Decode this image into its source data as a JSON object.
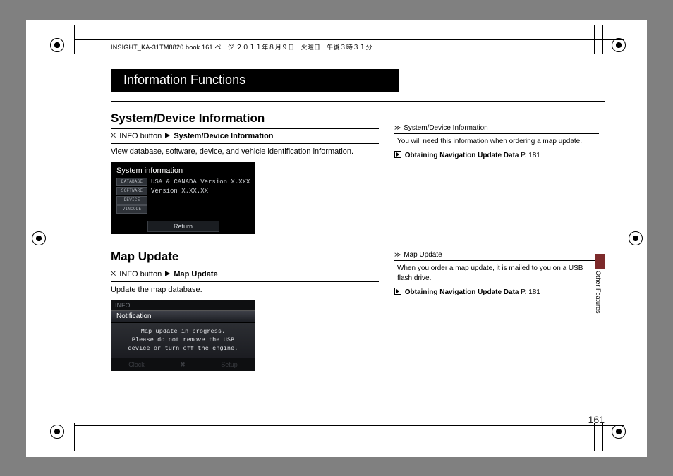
{
  "file_header": "INSIGHT_KA-31TM8820.book  161 ページ  ２０１１年８月９日　火曜日　午後３時３１分",
  "banner_title": "Information Functions",
  "section_a": {
    "heading": "System/Device Information",
    "nav_prefix": "INFO button",
    "nav_target": "System/Device Information",
    "body": "View database, software, device, and vehicle identification information.",
    "screenshot": {
      "title": "System information",
      "rows": {
        "database_label": "DATABASE",
        "database_value": "USA & CANADA Version X.XXX",
        "software_label": "SOFTWARE",
        "software_value": "Version X.XX.XX",
        "device_label": "DEVICE",
        "vincode_label": "VINCODE"
      },
      "return_btn": "Return"
    }
  },
  "section_b": {
    "heading": "Map Update",
    "nav_prefix": "INFO button",
    "nav_target": "Map Update",
    "body": "Update the map database.",
    "screenshot": {
      "top_label": "INFO",
      "notif_title": "Notification",
      "notif_line1": "Map update in progress.",
      "notif_line2": "Please do not remove the USB",
      "notif_line3": "device or turn off the engine.",
      "bottom_left": "Clock",
      "bottom_right": "Setup"
    }
  },
  "sidenote_a": {
    "title": "System/Device Information",
    "body": "You will need this information when ordering a map update.",
    "link_label": "Obtaining Navigation Update Data",
    "link_page": "P. 181"
  },
  "sidenote_b": {
    "title": "Map Update",
    "body": "When you order a map update, it is mailed to you on a USB flash drive.",
    "link_label": "Obtaining Navigation Update Data",
    "link_page": "P. 181"
  },
  "side_tab": "Other Features",
  "page_number": "161"
}
